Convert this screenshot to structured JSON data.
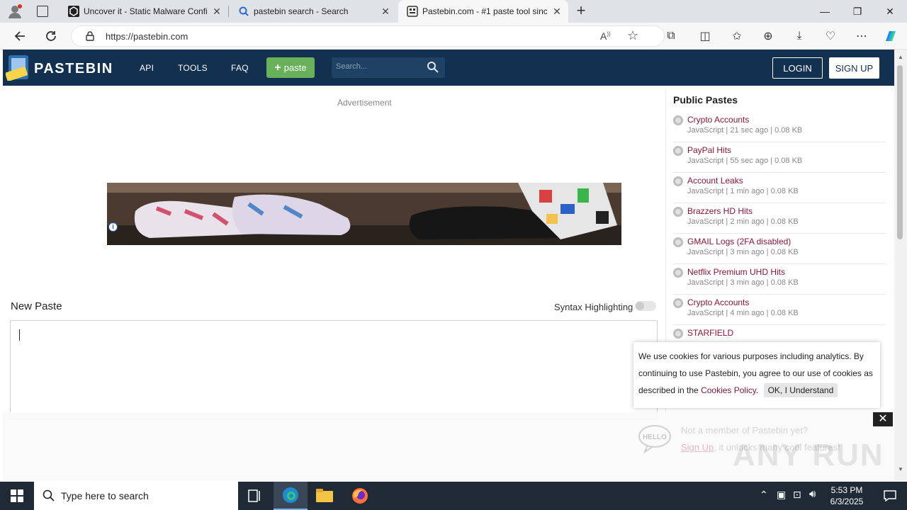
{
  "browser": {
    "tabs": [
      {
        "title": "Uncover it - Static Malware Confi",
        "icon": "hexagon-icon"
      },
      {
        "title": "pastebin search - Search",
        "icon": "search-icon"
      },
      {
        "title": "Pastebin.com - #1 paste tool sinc",
        "icon": "pastebin-icon",
        "active": true
      }
    ],
    "url": "https://pastebin.com"
  },
  "site": {
    "logo_text": "PASTEBIN",
    "nav": [
      "API",
      "TOOLS",
      "FAQ"
    ],
    "paste_button": "paste",
    "search_placeholder": "Search...",
    "login": "LOGIN",
    "signup": "SIGN UP"
  },
  "main": {
    "ad_label": "Advertisement",
    "new_paste": "New Paste",
    "syntax_label": "Syntax Highlighting"
  },
  "sidebar": {
    "title": "Public Pastes",
    "items": [
      {
        "title": "Crypto Accounts",
        "meta": "JavaScript | 21 sec ago | 0.08 KB"
      },
      {
        "title": "PayPal Hits",
        "meta": "JavaScript | 55 sec ago | 0.08 KB"
      },
      {
        "title": "Account Leaks",
        "meta": "JavaScript | 1 min ago | 0.08 KB"
      },
      {
        "title": "Brazzers HD Hits",
        "meta": "JavaScript | 2 min ago | 0.08 KB"
      },
      {
        "title": "GMAIL Logs (2FA disabled)",
        "meta": "JavaScript | 3 min ago | 0.08 KB"
      },
      {
        "title": "Netflix Premium UHD Hits",
        "meta": "JavaScript | 3 min ago | 0.08 KB"
      },
      {
        "title": "Crypto Accounts",
        "meta": "JavaScript | 4 min ago | 0.08 KB"
      },
      {
        "title": "STARFIELD",
        "meta": ""
      }
    ]
  },
  "cookie": {
    "text": "We use cookies for various purposes including analytics. By continuing to use Pastebin, you agree to our use of cookies as described in the ",
    "link": "Cookies Policy",
    "period": ".",
    "ok": "OK, I Understand"
  },
  "promo": {
    "question": "Not a member of Pastebin yet?",
    "signup_link": "Sign Up",
    "rest": ", it unlocks many cool features!"
  },
  "watermark": "ANY RUN",
  "taskbar": {
    "search_placeholder": "Type here to search",
    "time": "5:53 PM",
    "date": "6/3/2025"
  },
  "colors": {
    "nav_bg": "#12304f",
    "paste_green": "#68b15a",
    "link_red": "#8a1538"
  }
}
